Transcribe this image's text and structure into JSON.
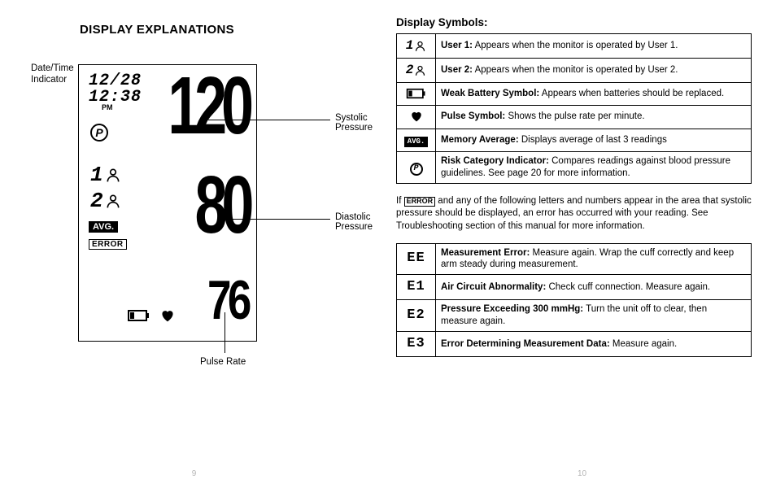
{
  "leftPage": {
    "heading": "DISPLAY EXPLANATIONS",
    "callouts": {
      "dateTime": "Date/Time Indicator",
      "systolic": "Systolic Pressure",
      "diastolic": "Diastolic Pressure",
      "pulse": "Pulse Rate"
    },
    "lcd": {
      "date": "12/28",
      "time": "12:38",
      "ampm": "PM",
      "riskLetter": "P",
      "user1": "1",
      "user2": "2",
      "avg": "AVG.",
      "error": "ERROR",
      "systolic": "120",
      "diastolic": "80",
      "pulse": "76"
    },
    "pageNumber": "9"
  },
  "rightPage": {
    "heading": "Display Symbols:",
    "symbols": [
      {
        "iconText": "1",
        "iconType": "user",
        "label": "User 1:",
        "desc": "Appears when the monitor is operated by User 1."
      },
      {
        "iconText": "2",
        "iconType": "user",
        "label": "User 2:",
        "desc": "Appears when the monitor is operated by User 2."
      },
      {
        "iconType": "battery",
        "label": "Weak Battery Symbol:",
        "desc": "Appears when batteries should be replaced."
      },
      {
        "iconType": "heart",
        "label": "Pulse Symbol:",
        "desc": "Shows the pulse rate per minute."
      },
      {
        "iconType": "avg",
        "iconText": "AVG.",
        "label": "Memory Average:",
        "desc": "Displays average of last 3 readings"
      },
      {
        "iconType": "risk",
        "iconText": "P",
        "label": "Risk Category Indicator:",
        "desc": "Compares readings against blood pressure guidelines. See page 20 for more information."
      }
    ],
    "errorPara": {
      "prefix": "If ",
      "errorBadge": "ERROR",
      "rest": " and any of the following letters and numbers appear in the area that systolic pressure should be displayed, an error has occurred with your reading. See Troubleshooting section of this manual for more information."
    },
    "errors": [
      {
        "code": "EE",
        "label": "Measurement Error:",
        "desc": "Measure again. Wrap the cuff correctly and keep arm steady during measurement."
      },
      {
        "code": "E1",
        "label": "Air Circuit Abnormality:",
        "desc": "Check cuff connection. Measure again."
      },
      {
        "code": "E2",
        "label": "Pressure Exceeding 300 mmHg:",
        "desc": "Turn the unit off to clear, then measure again."
      },
      {
        "code": "E3",
        "label": "Error Determining Measurement Data:",
        "desc": "Measure again."
      }
    ],
    "pageNumber": "10"
  }
}
